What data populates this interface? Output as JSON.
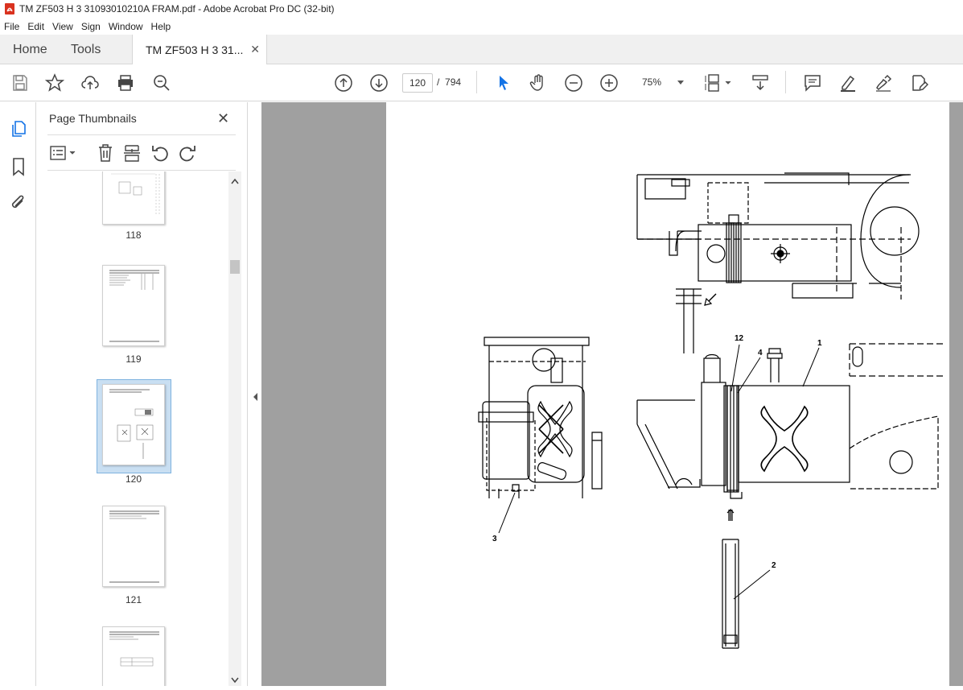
{
  "window": {
    "title": "TM ZF503 H  3 31093010210A FRAM.pdf - Adobe Acrobat Pro DC (32-bit)"
  },
  "menu": [
    "File",
    "Edit",
    "View",
    "Sign",
    "Window",
    "Help"
  ],
  "tabs": {
    "home": "Home",
    "tools": "Tools",
    "document": "TM ZF503 H  3 31..."
  },
  "toolbar": {
    "current_page": "120",
    "page_separator": "/",
    "total_pages": "794",
    "zoom": "75%"
  },
  "panel": {
    "title": "Page Thumbnails"
  },
  "thumbnails": [
    {
      "label": "118"
    },
    {
      "label": "119"
    },
    {
      "label": "120",
      "selected": true
    },
    {
      "label": "121"
    },
    {
      "label": ""
    }
  ],
  "drawing_labels": {
    "l12": "12",
    "l4": "4",
    "l1": "1",
    "l3": "3",
    "l2": "2"
  },
  "colors": {
    "accent": "#1473e6",
    "doc_background": "#a0a0a0",
    "pdf_icon": "#d9321f"
  }
}
